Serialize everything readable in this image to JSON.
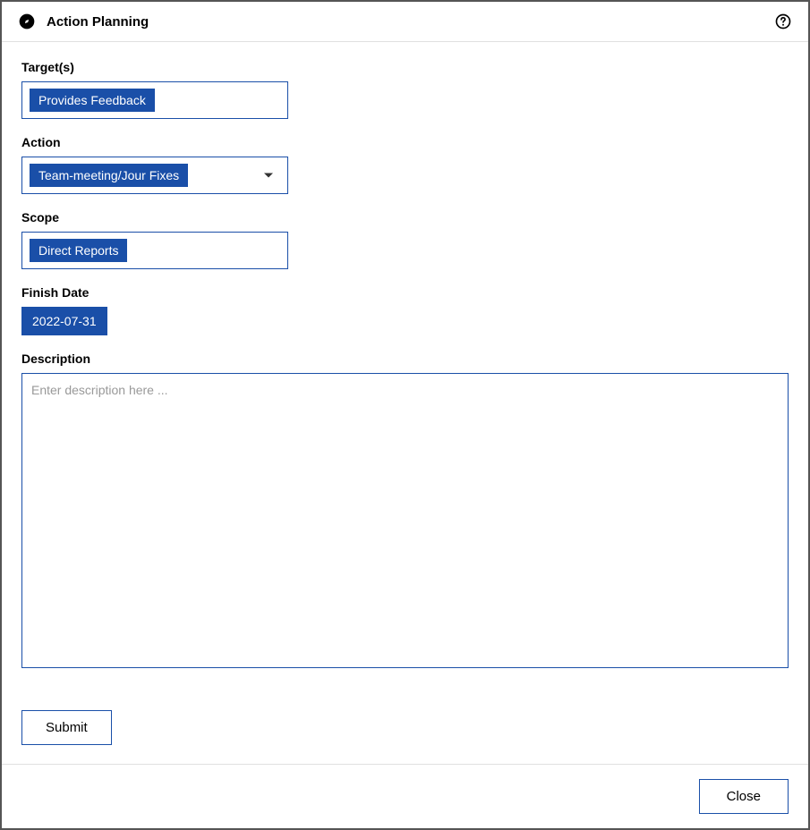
{
  "header": {
    "title": "Action Planning"
  },
  "form": {
    "targets": {
      "label": "Target(s)",
      "value": "Provides Feedback"
    },
    "action": {
      "label": "Action",
      "value": "Team-meeting/Jour Fixes"
    },
    "scope": {
      "label": "Scope",
      "value": "Direct Reports"
    },
    "finish_date": {
      "label": "Finish Date",
      "value": "2022-07-31"
    },
    "description": {
      "label": "Description",
      "placeholder": "Enter description here ...",
      "value": ""
    },
    "submit_label": "Submit"
  },
  "footer": {
    "close_label": "Close"
  }
}
